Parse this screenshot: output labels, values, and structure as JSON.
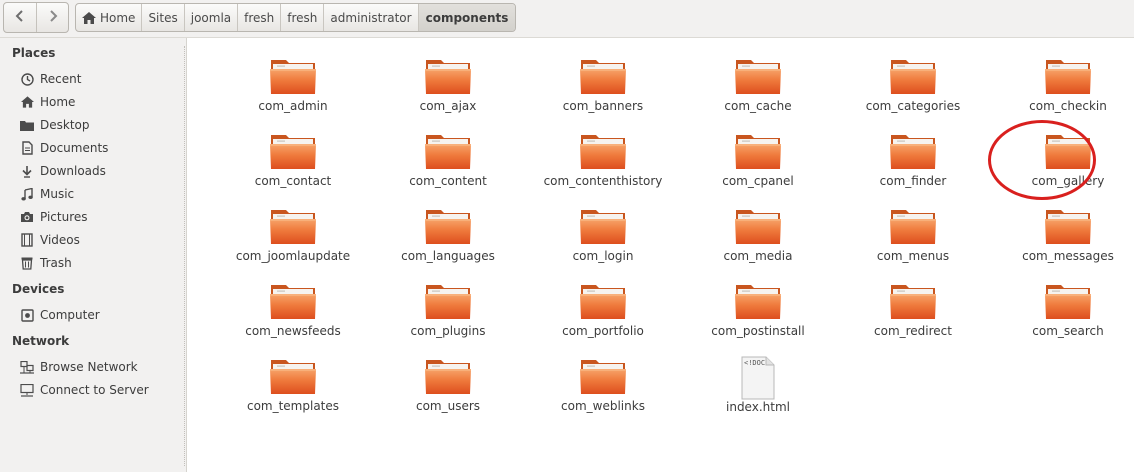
{
  "toolbar": {
    "back_icon": "chevron-left-icon",
    "forward_icon": "chevron-right-icon",
    "breadcrumbs": [
      "Home",
      "Sites",
      "joomla",
      "fresh",
      "fresh",
      "administrator",
      "components"
    ]
  },
  "sidebar": {
    "sections": [
      {
        "title": "Places",
        "items": [
          {
            "label": "Recent",
            "icon": "clock-icon"
          },
          {
            "label": "Home",
            "icon": "home-icon"
          },
          {
            "label": "Desktop",
            "icon": "folder-icon"
          },
          {
            "label": "Documents",
            "icon": "document-icon"
          },
          {
            "label": "Downloads",
            "icon": "download-icon"
          },
          {
            "label": "Music",
            "icon": "music-icon"
          },
          {
            "label": "Pictures",
            "icon": "camera-icon"
          },
          {
            "label": "Videos",
            "icon": "film-icon"
          },
          {
            "label": "Trash",
            "icon": "trash-icon"
          }
        ]
      },
      {
        "title": "Devices",
        "items": [
          {
            "label": "Computer",
            "icon": "drive-icon"
          }
        ]
      },
      {
        "title": "Network",
        "items": [
          {
            "label": "Browse Network",
            "icon": "network-icon"
          },
          {
            "label": "Connect to Server",
            "icon": "server-icon"
          }
        ]
      }
    ]
  },
  "files": [
    {
      "name": "com_admin",
      "type": "folder"
    },
    {
      "name": "com_ajax",
      "type": "folder"
    },
    {
      "name": "com_banners",
      "type": "folder"
    },
    {
      "name": "com_cache",
      "type": "folder"
    },
    {
      "name": "com_categories",
      "type": "folder"
    },
    {
      "name": "com_checkin",
      "type": "folder"
    },
    {
      "name": "com_contact",
      "type": "folder"
    },
    {
      "name": "com_content",
      "type": "folder"
    },
    {
      "name": "com_contenthistory",
      "type": "folder"
    },
    {
      "name": "com_cpanel",
      "type": "folder"
    },
    {
      "name": "com_finder",
      "type": "folder"
    },
    {
      "name": "com_gallery",
      "type": "folder",
      "highlighted": true
    },
    {
      "name": "com_joomlaupdate",
      "type": "folder"
    },
    {
      "name": "com_languages",
      "type": "folder"
    },
    {
      "name": "com_login",
      "type": "folder"
    },
    {
      "name": "com_media",
      "type": "folder"
    },
    {
      "name": "com_menus",
      "type": "folder"
    },
    {
      "name": "com_messages",
      "type": "folder"
    },
    {
      "name": "com_newsfeeds",
      "type": "folder"
    },
    {
      "name": "com_plugins",
      "type": "folder"
    },
    {
      "name": "com_portfolio",
      "type": "folder"
    },
    {
      "name": "com_postinstall",
      "type": "folder"
    },
    {
      "name": "com_redirect",
      "type": "folder"
    },
    {
      "name": "com_search",
      "type": "folder"
    },
    {
      "name": "com_templates",
      "type": "folder"
    },
    {
      "name": "com_users",
      "type": "folder"
    },
    {
      "name": "com_weblinks",
      "type": "folder"
    },
    {
      "name": "index.html",
      "type": "html",
      "preview_text": "<!DOC"
    }
  ],
  "colors": {
    "folder_orange": "#e8602a",
    "folder_light": "#f7a46a",
    "highlight_ring": "#d9201e"
  }
}
